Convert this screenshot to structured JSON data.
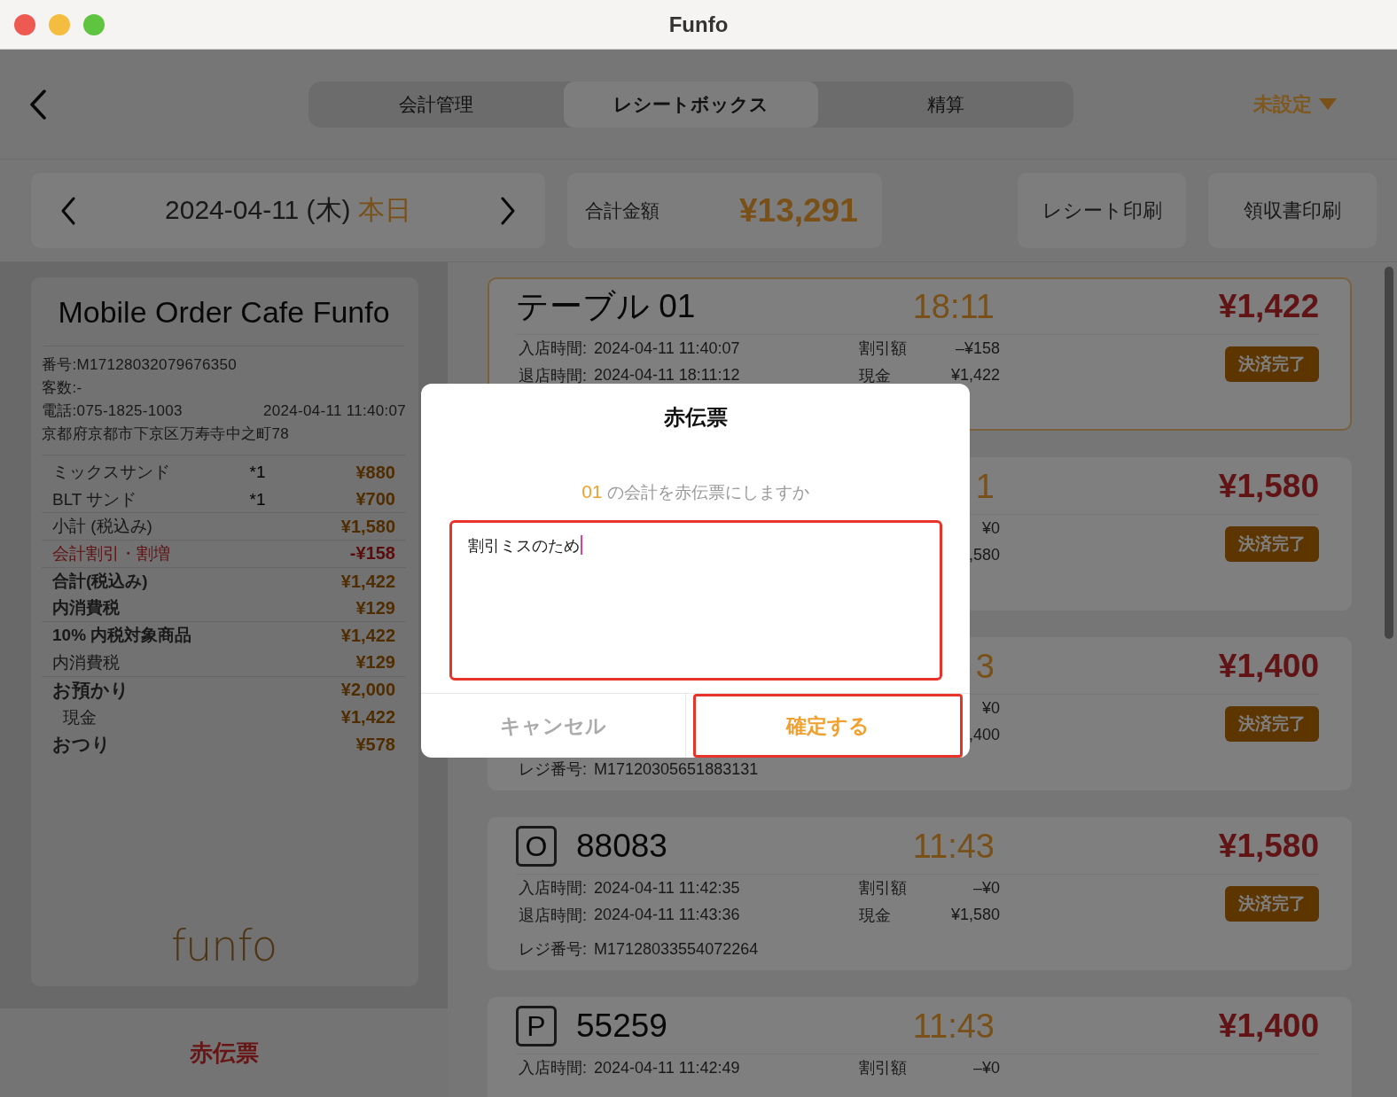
{
  "window": {
    "title": "Funfo"
  },
  "tabs": [
    {
      "label": "会計管理",
      "selected": false
    },
    {
      "label": "レシートボックス",
      "selected": true
    },
    {
      "label": "精算",
      "selected": false
    }
  ],
  "store_selector": {
    "label": "未設定"
  },
  "date_bar": {
    "date": "2024-04-11 (木)",
    "today": "本日"
  },
  "total": {
    "label": "合計金額",
    "value": "¥13,291"
  },
  "print_buttons": [
    "レシート印刷",
    "領収書印刷"
  ],
  "receipt": {
    "store_name": "Mobile Order Cafe Funfo",
    "number": "番号:M17128032079676350",
    "guests": "客数:-",
    "phone": "電話:075-1825-1003",
    "datetime": "2024-04-11 11:40:07",
    "address": "京都府京都市下京区万寿寺中之町78",
    "lines": [
      {
        "kind": "item",
        "label": "ミックスサンド",
        "qty": "*1",
        "amount": "¥880",
        "rule_below": false
      },
      {
        "kind": "item",
        "label": "BLT サンド",
        "qty": "*1",
        "amount": "¥700",
        "rule_below": true
      },
      {
        "kind": "normal",
        "label": "小計 (税込み)",
        "amount": "¥1,580",
        "rule_below": true
      },
      {
        "kind": "discount",
        "label": "会計割引・割増",
        "amount": "-¥158",
        "rule_below": true
      },
      {
        "kind": "bold",
        "label": "合計(税込み)",
        "amount": "¥1,422",
        "rule_below": false
      },
      {
        "kind": "bold",
        "label": "内消費税",
        "amount": "¥129",
        "rule_below": true
      },
      {
        "kind": "bold",
        "label": "10% 内税対象商品",
        "amount": "¥1,422",
        "rule_below": false
      },
      {
        "kind": "normal",
        "label": "内消費税",
        "amount": "¥129",
        "rule_below": true
      },
      {
        "kind": "large",
        "label": "お預かり",
        "amount": "¥2,000",
        "rule_below": false
      },
      {
        "kind": "indent",
        "label": "現金",
        "amount": "¥1,422",
        "rule_below": false
      },
      {
        "kind": "large",
        "label": "おつり",
        "amount": "¥578",
        "rule_below": false
      }
    ],
    "logo": "funfo"
  },
  "red_slip_button": "赤伝票",
  "orders": [
    {
      "selected": true,
      "title": "テーブル 01",
      "time": "18:11",
      "total": "¥1,422",
      "entry_label": "入店時間:",
      "entry": "2024-04-11 11:40:07",
      "exit_label": "退店時間:",
      "exit": "2024-04-11 18:11:12",
      "discount_label": "割引額",
      "discount": "–¥158",
      "cash_label": "現金",
      "cash": "¥1,422",
      "status": "決済完了"
    },
    {
      "selected": false,
      "time": "1",
      "total": "¥1,580",
      "discount": "¥0",
      "cash": ",580",
      "status": "決済完了"
    },
    {
      "selected": false,
      "time": "3",
      "total": "¥1,400",
      "discount": "¥0",
      "cash": ",400",
      "register_label": "レジ番号:",
      "register": "M17120305651883131",
      "status": "決済完了"
    },
    {
      "selected": false,
      "badge": "O",
      "title": "88083",
      "time": "11:43",
      "total": "¥1,580",
      "entry_label": "入店時間:",
      "entry": "2024-04-11 11:42:35",
      "exit_label": "退店時間:",
      "exit": "2024-04-11 11:43:36",
      "register_label": "レジ番号:",
      "register": "M17128033554072264",
      "discount_label": "割引額",
      "discount": "–¥0",
      "cash_label": "現金",
      "cash": "¥1,580",
      "status": "決済完了"
    },
    {
      "selected": false,
      "badge": "P",
      "title": "55259",
      "time": "11:43",
      "total": "¥1,400",
      "entry_label": "入店時間:",
      "entry": "2024-04-11 11:42:49",
      "discount_label": "割引額",
      "discount": "–¥0"
    }
  ],
  "dialog": {
    "title": "赤伝票",
    "order_ref": "01",
    "message": "の会計を赤伝票にしますか",
    "reason": {
      "value": "割引ミスのため",
      "annotated": true
    },
    "cancel": {
      "label": "キャンセル",
      "annotated": false
    },
    "confirm": {
      "label": "確定する",
      "annotated": true
    }
  }
}
